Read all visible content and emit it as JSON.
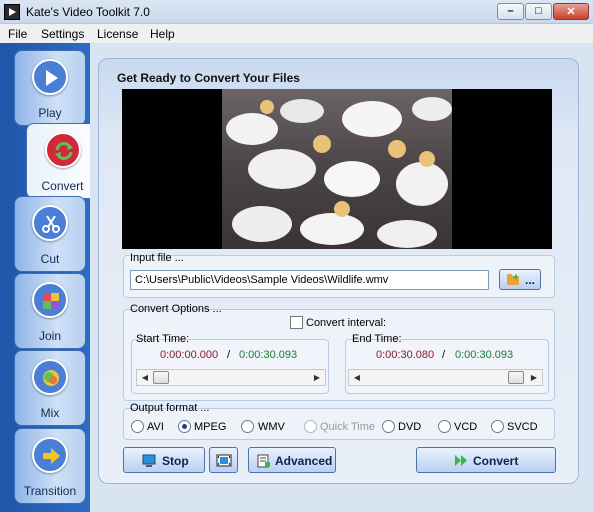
{
  "window": {
    "title": "Kate's Video Toolkit 7.0"
  },
  "menu": [
    "File",
    "Settings",
    "License",
    "Help"
  ],
  "sidebar": {
    "items": [
      {
        "label": "Play",
        "icon": "play-icon",
        "color": "#4a7fd6"
      },
      {
        "label": "Convert",
        "icon": "convert-icon",
        "color": "#d1283a",
        "active": true
      },
      {
        "label": "Cut",
        "icon": "scissors-icon",
        "color": "#4a7fd6"
      },
      {
        "label": "Join",
        "icon": "puzzle-icon",
        "color": "#4a7fd6"
      },
      {
        "label": "Mix",
        "icon": "mix-icon",
        "color": "#4a7fd6"
      },
      {
        "label": "Transition",
        "icon": "arrow-right-icon",
        "color": "#4a7fd6"
      }
    ]
  },
  "main": {
    "heading": "Get Ready to Convert Your Files",
    "input": {
      "title": "Input file ...",
      "value": "C:\\Users\\Public\\Videos\\Sample Videos\\Wildlife.wmv",
      "browse_label": "..."
    },
    "convert_options": {
      "title": "Convert Options ...",
      "interval_label": "Convert interval:",
      "interval_checked": false,
      "start": {
        "label": "Start Time:",
        "current": "0:00:00.000",
        "separator": "/",
        "total": "0:00:30.093",
        "position": 0.0
      },
      "end": {
        "label": "End Time:",
        "current": "0:00:30.080",
        "separator": "/",
        "total": "0:00:30.093",
        "position": 1.0
      }
    },
    "output": {
      "title": "Output format ...",
      "options": [
        {
          "label": "AVI",
          "checked": false,
          "disabled": false
        },
        {
          "label": "MPEG",
          "checked": true,
          "disabled": false
        },
        {
          "label": "WMV",
          "checked": false,
          "disabled": false
        },
        {
          "label": "Quick Time",
          "checked": false,
          "disabled": true
        },
        {
          "label": "DVD",
          "checked": false,
          "disabled": false
        },
        {
          "label": "VCD",
          "checked": false,
          "disabled": false
        },
        {
          "label": "SVCD",
          "checked": false,
          "disabled": false
        }
      ]
    },
    "buttons": {
      "stop": "Stop",
      "advanced": "Advanced",
      "convert": "Convert"
    }
  }
}
